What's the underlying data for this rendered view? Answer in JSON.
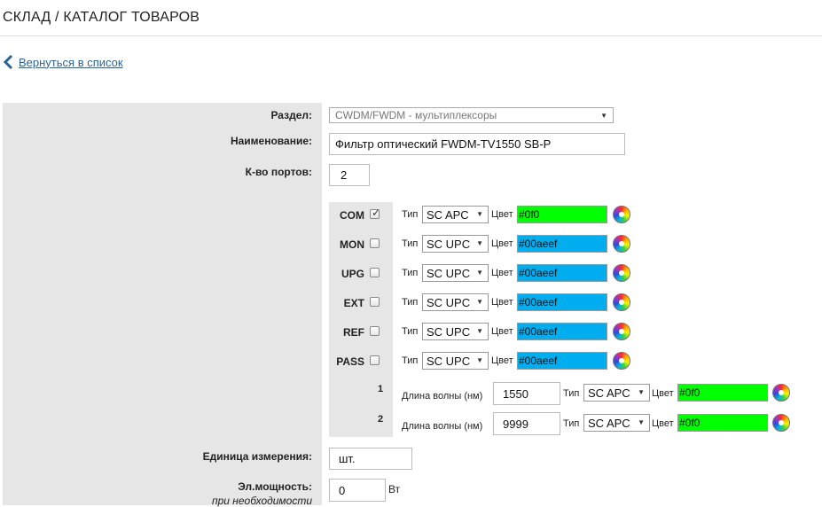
{
  "header": {
    "title": "СКЛАД / КАТАЛОГ ТОВАРОВ",
    "back_link": "Вернуться в список"
  },
  "form": {
    "section_label": "Раздел:",
    "section_value": "CWDM/FWDM - мультиплексоры",
    "name_label": "Наименование:",
    "name_value": "Фильтр оптический FWDM-TV1550 SB-P",
    "ports_label": "К-во портов:",
    "ports_value": "2",
    "unit_label": "Единица измерения:",
    "unit_value": "шт.",
    "power_label": "Эл.мощность:",
    "power_sub": "при необходимости",
    "power_value": "0",
    "power_unit": "Вт"
  },
  "labels": {
    "type": "Тип",
    "color": "Цвет",
    "wavelength": "Длина волны (нм)"
  },
  "ports": [
    {
      "name": "COM",
      "checked": true,
      "type": "SC APC",
      "color": "#0f0",
      "swatch": "#00ff00"
    },
    {
      "name": "MON",
      "checked": false,
      "type": "SC UPC",
      "color": "#00aeef",
      "swatch": "#00aeef"
    },
    {
      "name": "UPG",
      "checked": false,
      "type": "SC UPC",
      "color": "#00aeef",
      "swatch": "#00aeef"
    },
    {
      "name": "EXT",
      "checked": false,
      "type": "SC UPC",
      "color": "#00aeef",
      "swatch": "#00aeef"
    },
    {
      "name": "REF",
      "checked": false,
      "type": "SC UPC",
      "color": "#00aeef",
      "swatch": "#00aeef"
    },
    {
      "name": "PASS",
      "checked": false,
      "type": "SC UPC",
      "color": "#00aeef",
      "swatch": "#00aeef"
    }
  ],
  "wavelengths": [
    {
      "num": "1",
      "value": "1550",
      "type": "SC APC",
      "color": "#0f0",
      "swatch": "#00ff00"
    },
    {
      "num": "2",
      "value": "9999",
      "type": "SC APC",
      "color": "#0f0",
      "swatch": "#00ff00"
    }
  ],
  "colors": {
    "link": "#2a6496",
    "panel_bg": "#e6e6e6"
  }
}
